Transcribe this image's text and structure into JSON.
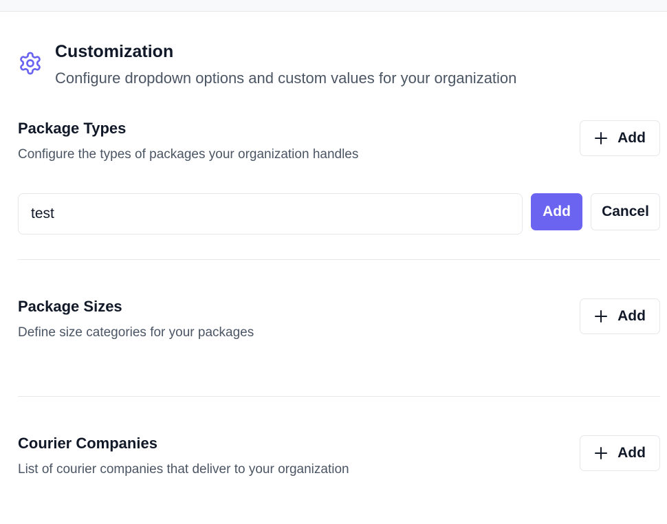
{
  "header": {
    "icon": "gear-icon",
    "title": "Customization",
    "subtitle": "Configure dropdown options and custom values for your organization"
  },
  "accent_color": "#6a64f1",
  "sections": [
    {
      "title": "Package Types",
      "description": "Configure the types of packages your organization handles",
      "add_label": "Add",
      "add_icon": "plus-icon",
      "form": {
        "input_value": "test",
        "submit_label": "Add",
        "cancel_label": "Cancel"
      }
    },
    {
      "title": "Package Sizes",
      "description": "Define size categories for your packages",
      "add_label": "Add",
      "add_icon": "plus-icon"
    },
    {
      "title": "Courier Companies",
      "description": "List of courier companies that deliver to your organization",
      "add_label": "Add",
      "add_icon": "plus-icon"
    }
  ]
}
